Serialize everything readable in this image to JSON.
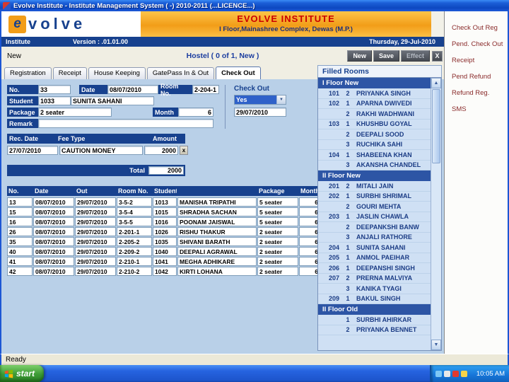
{
  "colors": {
    "accent_navy": "#17418e",
    "banner_orange": "#f29d18",
    "brand_red": "#cc0000",
    "nav_link_maroon": "#8a2b2b",
    "content_blue": "#b9d0e8",
    "list_blue": "#cfe0f4",
    "floor_header_blue": "#2d55a5"
  },
  "window": {
    "title": "Evolve Institute - Institute Management System ( -) 2010-2011 (...LICENCE...)"
  },
  "header": {
    "logo_letter": "e",
    "logo_text": "volve",
    "institute_name": "EVOLVE INSTITUTE",
    "address": "I Floor,Mainashree Complex, Dewas (M.P.)"
  },
  "info_bar": {
    "left": "Institute",
    "version": "Version : .01.01.00",
    "date": "Thursday, 29-Jul-2010"
  },
  "toolbar": {
    "new_tab": "New",
    "context": "Hostel  ( 0 of 1, New )",
    "buttons": [
      {
        "label": "New",
        "enabled": true
      },
      {
        "label": "Save",
        "enabled": true
      },
      {
        "label": "Effect",
        "enabled": false
      }
    ],
    "close": "X"
  },
  "tabs": [
    "Registration",
    "Receipt",
    "House Keeping",
    "GatePass In & Out",
    "Check Out"
  ],
  "active_tab": "Check Out",
  "right_nav": {
    "items": [
      "Check Out Reg",
      "Pend. Check Out",
      "Receipt",
      "Pend Refund",
      "Refund Reg.",
      "SMS"
    ]
  },
  "form": {
    "no_label": "No.",
    "no_value": "33",
    "date_label": "Date",
    "date_value": "08/07/2010",
    "room_label": "Room No.",
    "room_value": "2-204-1",
    "student_label": "Student",
    "student_id": "1033",
    "student_name": "SUNITA SAHANI",
    "package_label": "Package",
    "package_value": "2 seater",
    "month_label": "Month",
    "month_value": "6",
    "remark_label": "Remark",
    "remark_value": "",
    "checkout_label": "Check Out",
    "checkout_value": "Yes",
    "checkout_date": "29/07/2010"
  },
  "fee_table": {
    "headers": [
      "Rec. Date",
      "Fee Type",
      "Amount"
    ],
    "rows": [
      {
        "date": "27/07/2010",
        "type": "CAUTION MONEY",
        "amount": "2000"
      }
    ],
    "delete_label": "x",
    "total_label": "Total",
    "total_value": "2000"
  },
  "checkout_table": {
    "headers": [
      "No.",
      "Date",
      "Out",
      "Room No.",
      "Student",
      "",
      "Package",
      "Month"
    ],
    "rows": [
      [
        "13",
        "08/07/2010",
        "29/07/2010",
        "3-5-2",
        "1013",
        "MANISHA TRIPATHI",
        "5 seater",
        "6"
      ],
      [
        "15",
        "08/07/2010",
        "29/07/2010",
        "3-5-4",
        "1015",
        "SHRADHA SACHAN",
        "5 seater",
        "6"
      ],
      [
        "16",
        "08/07/2010",
        "29/07/2010",
        "3-5-5",
        "1016",
        "POONAM JAISWAL",
        "5 seater",
        "6"
      ],
      [
        "26",
        "08/07/2010",
        "29/07/2010",
        "2-201-1",
        "1026",
        "RISHU THAKUR",
        "2 seater",
        "6"
      ],
      [
        "35",
        "08/07/2010",
        "29/07/2010",
        "2-205-2",
        "1035",
        "SHIVANI BARATH",
        "2 seater",
        "6"
      ],
      [
        "40",
        "08/07/2010",
        "29/07/2010",
        "2-209-2",
        "1040",
        "DEEPALI AGRAWAL",
        "2 seater",
        "6"
      ],
      [
        "41",
        "08/07/2010",
        "29/07/2010",
        "2-210-1",
        "1041",
        "MEGHA ADHIKARE",
        "2 seater",
        "6"
      ],
      [
        "42",
        "08/07/2010",
        "29/07/2010",
        "2-210-2",
        "1042",
        "KIRTI LOHANA",
        "2 seater",
        "6"
      ]
    ]
  },
  "filled_rooms": {
    "title": "Filled Rooms",
    "sections": [
      {
        "header": "I Floor New",
        "rows": [
          {
            "room": "101",
            "seat": "2",
            "name": "PRIYANKA SINGH"
          },
          {
            "room": "102",
            "seat": "1",
            "name": "APARNA DWIVEDI"
          },
          {
            "room": "",
            "seat": "2",
            "name": "RAKHI WADHWANI"
          },
          {
            "room": "103",
            "seat": "1",
            "name": "KHUSHBU GOYAL"
          },
          {
            "room": "",
            "seat": "2",
            "name": "DEEPALI SOOD"
          },
          {
            "room": "",
            "seat": "3",
            "name": "RUCHIKA SAHI"
          },
          {
            "room": "104",
            "seat": "1",
            "name": "SHABEENA KHAN"
          },
          {
            "room": "",
            "seat": "3",
            "name": "AKANSHA CHANDEL"
          }
        ]
      },
      {
        "header": "II Floor New",
        "rows": [
          {
            "room": "201",
            "seat": "2",
            "name": "MITALI JAIN"
          },
          {
            "room": "202",
            "seat": "1",
            "name": "SURBHI SHRIMAL"
          },
          {
            "room": "",
            "seat": "2",
            "name": "GOURI MEHTA"
          },
          {
            "room": "203",
            "seat": "1",
            "name": "JASLIN CHAWLA"
          },
          {
            "room": "",
            "seat": "2",
            "name": "DEEPANKSHI BANW"
          },
          {
            "room": "",
            "seat": "3",
            "name": "ANJALI RATHORE"
          },
          {
            "room": "204",
            "seat": "1",
            "name": "SUNITA SAHANI"
          },
          {
            "room": "205",
            "seat": "1",
            "name": "ANMOL PAEIHAR"
          },
          {
            "room": "206",
            "seat": "1",
            "name": "DEEPANSHI SINGH"
          },
          {
            "room": "207",
            "seat": "2",
            "name": "PRERNA MALVIYA"
          },
          {
            "room": "",
            "seat": "3",
            "name": "KANIKA TYAGI"
          },
          {
            "room": "209",
            "seat": "1",
            "name": "BAKUL SINGH"
          }
        ]
      },
      {
        "header": "II Floor Old",
        "rows": [
          {
            "room": "",
            "seat": "1",
            "name": "SURBHI AHIRKAR"
          },
          {
            "room": "",
            "seat": "2",
            "name": "PRIYANKA BENNET"
          }
        ]
      }
    ]
  },
  "status_bar": "Ready",
  "taskbar": {
    "start": "start",
    "time": "10:05 AM",
    "tray_icons": [
      {
        "name": "tray-messenger",
        "color": "#7ec8f5"
      },
      {
        "name": "tray-volume",
        "color": "#e8e8e8"
      },
      {
        "name": "tray-antivirus",
        "color": "#e03a2f"
      },
      {
        "name": "tray-network",
        "color": "#f5d44a"
      }
    ]
  }
}
